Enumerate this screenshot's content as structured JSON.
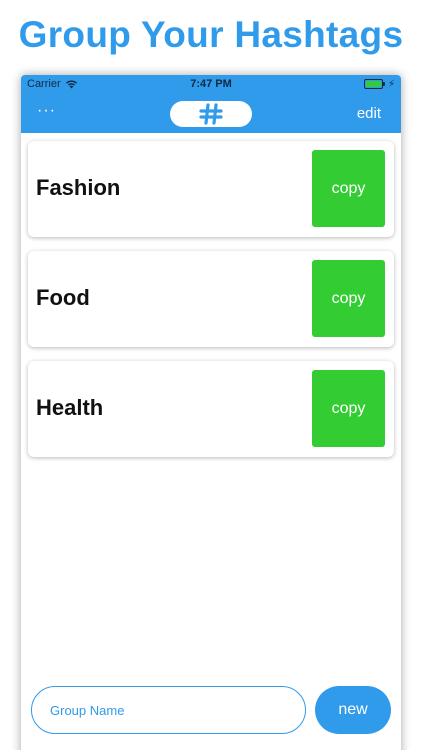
{
  "promo": {
    "title": "Group Your Hashtags"
  },
  "status_bar": {
    "carrier": "Carrier",
    "time": "7:47 PM",
    "battery_level": 1.0
  },
  "nav": {
    "more_label": "···",
    "logo_icon": "hashtag-icon",
    "edit_label": "edit"
  },
  "groups": [
    {
      "name": "Fashion",
      "copy_label": "copy"
    },
    {
      "name": "Food",
      "copy_label": "copy"
    },
    {
      "name": "Health",
      "copy_label": "copy"
    }
  ],
  "composer": {
    "placeholder": "Group Name",
    "value": "",
    "new_label": "new"
  },
  "colors": {
    "accent": "#2f9bea",
    "copy_button": "#33cc33",
    "text": "#111111"
  }
}
